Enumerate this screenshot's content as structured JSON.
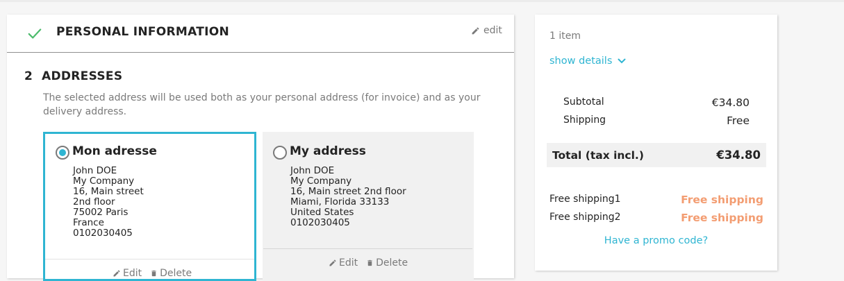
{
  "steps": {
    "personal": {
      "title": "Personal Information",
      "edit_label": "edit"
    },
    "addresses": {
      "number": "2",
      "title": "Addresses",
      "description": "The selected address will be used both as your personal address (for invoice) and as your delivery address."
    }
  },
  "addresses": [
    {
      "alias": "Mon adresse",
      "selected": true,
      "lines": [
        "John DOE",
        "My Company",
        "16, Main street",
        "2nd floor",
        "75002 Paris",
        "France",
        "0102030405"
      ],
      "edit_label": "Edit",
      "delete_label": "Delete"
    },
    {
      "alias": "My address",
      "selected": false,
      "lines": [
        "John DOE",
        "My Company",
        "16, Main street 2nd floor",
        "Miami, Florida 33133",
        "United States",
        "0102030405"
      ],
      "edit_label": "Edit",
      "delete_label": "Delete"
    }
  ],
  "summary": {
    "items_count": "1 item",
    "show_details": "show details",
    "subtotal_label": "Subtotal",
    "subtotal_value": "€34.80",
    "shipping_label": "Shipping",
    "shipping_value": "Free",
    "total_label": "Total (tax incl.)",
    "total_value": "€34.80",
    "discounts": [
      {
        "label": "Free shipping1",
        "value": "Free shipping"
      },
      {
        "label": "Free shipping2",
        "value": "Free shipping"
      }
    ],
    "promo_label": "Have a promo code?"
  },
  "colors": {
    "accent": "#2fb5d2",
    "success": "#4cbb6c",
    "discount": "#f39d72"
  },
  "icons": [
    "check-icon",
    "pencil-icon",
    "chevron-down-icon",
    "trash-icon"
  ]
}
